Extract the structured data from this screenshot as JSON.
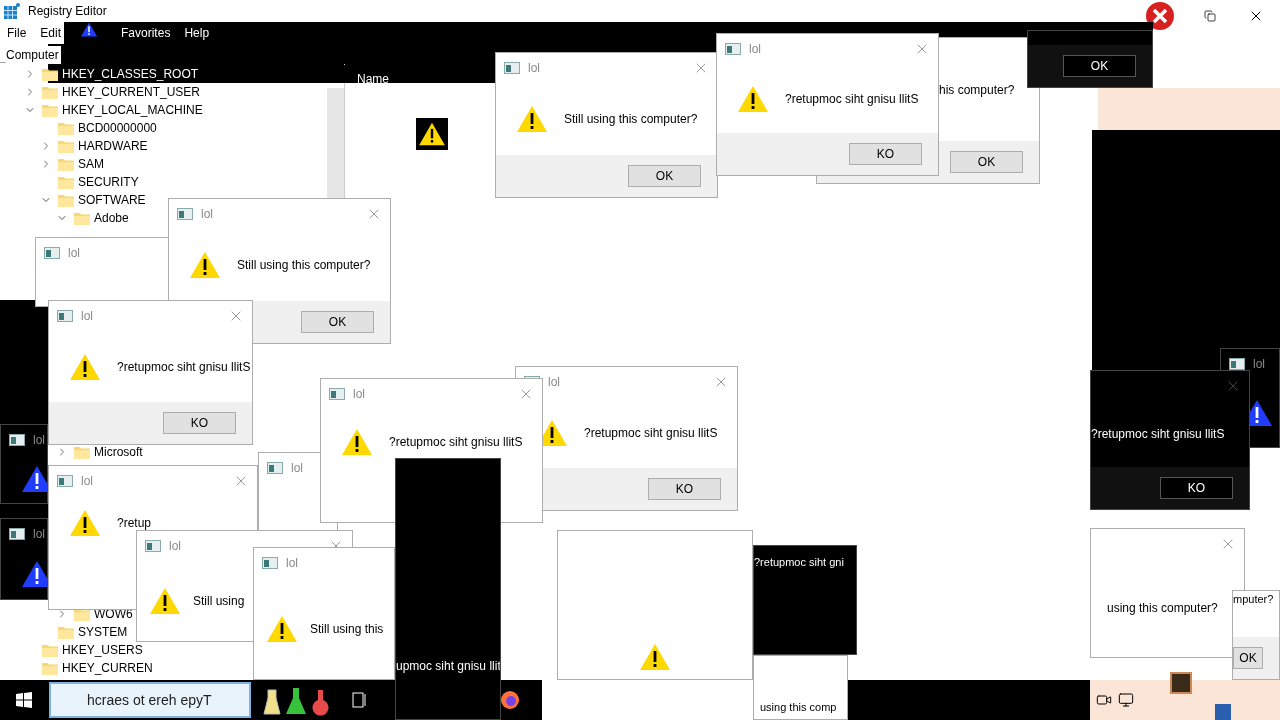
{
  "registry": {
    "title": "Registry Editor",
    "menu": [
      {
        "label": "File",
        "inverted": false
      },
      {
        "label": "Edit",
        "inverted": false
      },
      {
        "label": "Favorites",
        "inverted": true
      },
      {
        "label": "Help",
        "inverted": true
      }
    ],
    "address": "Computer",
    "column": "Name",
    "tree": [
      {
        "label": "HKEY_CLASSES_ROOT",
        "expanded": false
      },
      {
        "label": "HKEY_CURRENT_USER",
        "expanded": false
      },
      {
        "label": "HKEY_LOCAL_MACHINE",
        "expanded": true,
        "children": [
          {
            "label": "BCD00000000"
          },
          {
            "label": "HARDWARE",
            "expanded": false
          },
          {
            "label": "SAM",
            "expanded": false
          },
          {
            "label": "SECURITY"
          },
          {
            "label": "SOFTWARE",
            "expanded": true,
            "children": [
              {
                "label": "Adobe",
                "expanded": true
              },
              {
                "label": "Microsoft",
                "expanded": false
              },
              {
                "label": "WOW6",
                "expanded": false
              }
            ]
          },
          {
            "label": "SYSTEM"
          }
        ]
      },
      {
        "label": "HKEY_USERS"
      },
      {
        "label": "HKEY_CURREN"
      }
    ]
  },
  "dialogs": [
    {
      "kind": "light",
      "title": "lol"
    },
    {
      "kind": "light",
      "title": "lol",
      "message": "Still using this computer?",
      "button": "OK",
      "closable": true
    },
    {
      "kind": "light",
      "title": "lol",
      "message": "Still using this computer?",
      "button": "OK",
      "closable": true
    },
    {
      "kind": "light",
      "message": "his computer?",
      "button": "OK"
    },
    {
      "kind": "light",
      "title": "lol",
      "message": "?retupmoc siht gnisu llitS",
      "button": "KO",
      "closable": true
    },
    {
      "kind": "light",
      "title": "lol",
      "message": "?retupmoc siht gnisu llitS",
      "button": "KO",
      "closable": true
    },
    {
      "kind": "light",
      "title": "lol",
      "message": "?retupmoc siht gnisu llitS",
      "button": "KO",
      "closable": true
    },
    {
      "kind": "light",
      "title": "lol"
    },
    {
      "kind": "light",
      "title": "lol",
      "message": "?retupmoc siht gnisu llitS",
      "closable": true
    },
    {
      "kind": "light",
      "title": "lol",
      "message": "?retup",
      "closable": true
    },
    {
      "kind": "light",
      "title": "lol",
      "message": "Still using",
      "closable": true
    },
    {
      "kind": "light",
      "title": "lol",
      "message": "Still using this"
    },
    {
      "kind": "dark",
      "message": "upmoc siht gnisu llit"
    },
    {
      "kind": "light"
    },
    {
      "kind": "dark",
      "message": "?retupmoc siht gni"
    },
    {
      "kind": "dark",
      "title": "lol"
    },
    {
      "kind": "dark",
      "message": "?retupmoc siht gnisu llitS",
      "button": "KO",
      "closable": true
    },
    {
      "kind": "light",
      "message": "using this computer?",
      "closable": true
    },
    {
      "kind": "light",
      "message": "mputer?",
      "button": "OK"
    },
    {
      "kind": "dark",
      "button": "OK"
    },
    {
      "kind": "dark",
      "title": "lol"
    },
    {
      "kind": "dark",
      "title": "lol"
    },
    {
      "kind": "light",
      "message": "using this comp"
    }
  ],
  "taskbar": {
    "search": {
      "placeholder": "hcraes ot ereh epyT"
    }
  }
}
